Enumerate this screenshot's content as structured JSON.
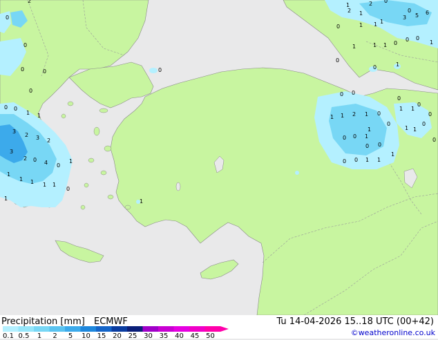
{
  "header": {
    "title": "Precipitation [mm]",
    "model": "ECMWF",
    "valid_time": "Tu 14-04-2026 15..18 UTC (00+42)"
  },
  "footer": {
    "copyright": "©weatheronline.co.uk"
  },
  "legend": {
    "ticks": [
      "0.1",
      "0.5",
      "1",
      "2",
      "5",
      "10",
      "15",
      "20",
      "25",
      "30",
      "35",
      "40",
      "45",
      "50"
    ],
    "colors": [
      "#b4f0ff",
      "#96e6fa",
      "#78d7f5",
      "#5ac3f0",
      "#3caaeb",
      "#1e87dc",
      "#1464c8",
      "#0a3ca0",
      "#0a1e78",
      "#a000c8",
      "#c800d2",
      "#e600e1",
      "#f000c8",
      "#ff00aa"
    ]
  },
  "colors": {
    "land": "#c8f5a0",
    "sea": "#e9e9ea",
    "precip_light": "#b4f0ff",
    "precip_medium": "#78d7f5",
    "precip_heavy": "#3caaeb"
  },
  "map_values": [
    "2",
    "0",
    "0",
    "0",
    "0",
    "0",
    "0",
    "0",
    "1",
    "1",
    "3",
    "2",
    "3",
    "2",
    "2",
    "4",
    "0",
    "0",
    "1",
    "1",
    "1",
    "1",
    "3",
    "1",
    "1",
    "1",
    "0",
    "1",
    "0",
    "0",
    "1",
    "1",
    "0",
    "0",
    "1",
    "1",
    "2",
    "1",
    "0",
    "0",
    "0",
    "1",
    "0",
    "0",
    "1",
    "1",
    "1",
    "1",
    "1",
    "1",
    "0",
    "0",
    "0",
    "0",
    "1",
    "1",
    "1",
    "0",
    "0",
    "0",
    "0",
    "1",
    "1",
    "1",
    "3",
    "5",
    "6",
    "0",
    "0",
    "1",
    "2",
    "1",
    "2",
    "0",
    "0",
    "1",
    "0",
    "1",
    "0",
    "0"
  ]
}
